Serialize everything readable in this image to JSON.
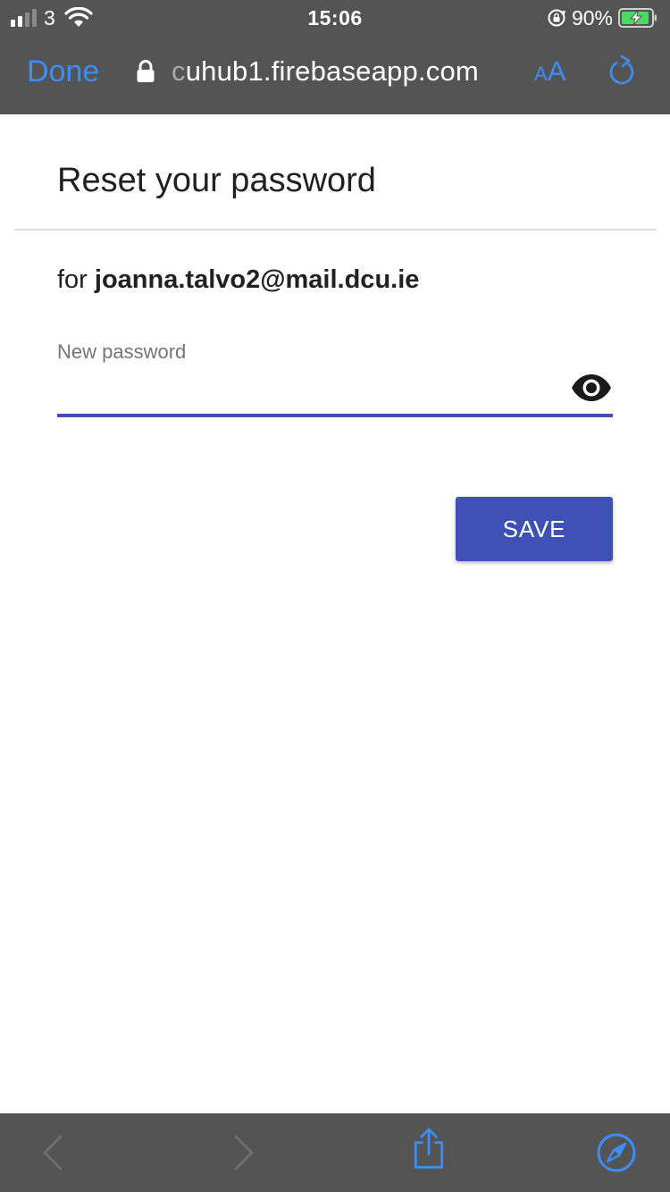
{
  "status_bar": {
    "carrier": "3",
    "time": "15:06",
    "battery_percent": "90%"
  },
  "browser": {
    "done_label": "Done",
    "url_faded": "c",
    "url": "uhub1.firebaseapp.com",
    "text_size_small": "A",
    "text_size_large": "A"
  },
  "page": {
    "title": "Reset your password",
    "for_prefix": "for",
    "email": "joanna.talvo2@mail.dcu.ie",
    "field_label": "New password",
    "field_value": "",
    "save_label": "SAVE"
  },
  "colors": {
    "chrome": "#545454",
    "link_blue": "#3e8ef7",
    "primary": "#3f51b5"
  },
  "icons": {
    "status": [
      "signal-icon",
      "wifi-icon",
      "rotation-lock-icon",
      "battery-charging-icon"
    ],
    "nav": [
      "padlock-icon",
      "reload-icon"
    ],
    "field": [
      "eye-icon"
    ],
    "toolbar": [
      "back-arrow-icon",
      "forward-arrow-icon",
      "share-icon",
      "compass-icon"
    ]
  }
}
